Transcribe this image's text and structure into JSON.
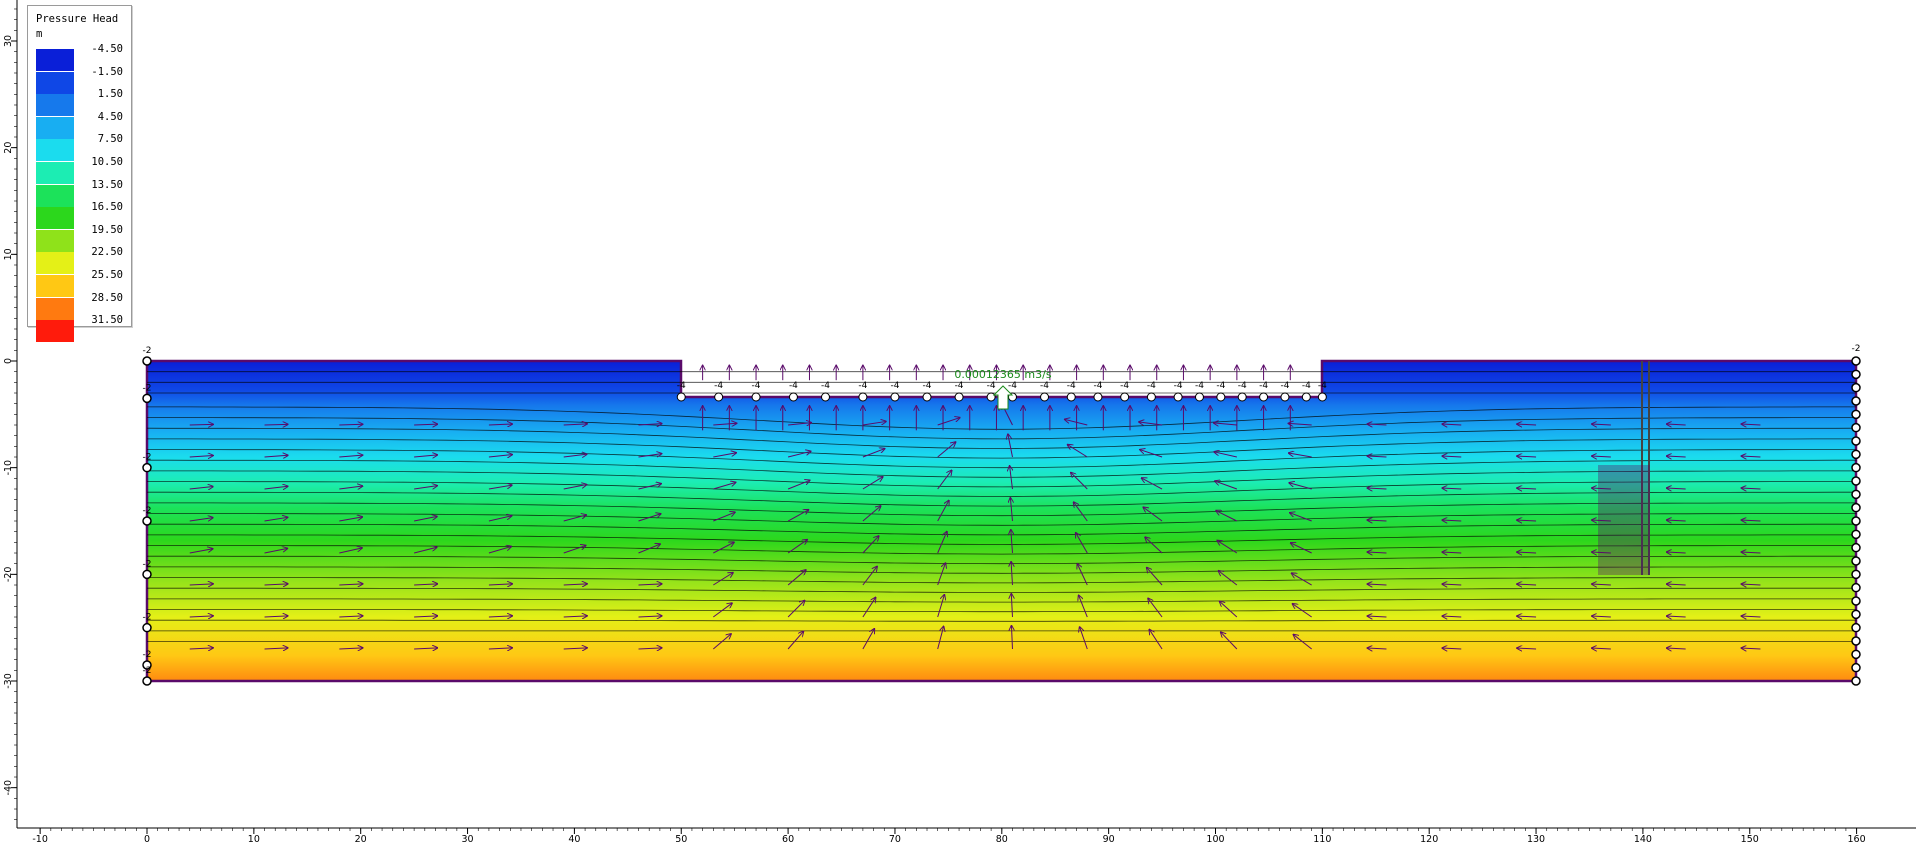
{
  "legend": {
    "title": "Pressure Head",
    "unit": "m",
    "entries": [
      {
        "label": "-4.50",
        "color": "#0a1fd8"
      },
      {
        "label": "-1.50",
        "color": "#0f47e6"
      },
      {
        "label": "1.50",
        "color": "#1679ec"
      },
      {
        "label": "4.50",
        "color": "#18aef2"
      },
      {
        "label": "7.50",
        "color": "#1bdcee"
      },
      {
        "label": "10.50",
        "color": "#1cedb3"
      },
      {
        "label": "13.50",
        "color": "#1ce25a"
      },
      {
        "label": "16.50",
        "color": "#2cd71c"
      },
      {
        "label": "19.50",
        "color": "#8fe21a"
      },
      {
        "label": "22.50",
        "color": "#e4f017"
      },
      {
        "label": "25.50",
        "color": "#ffc814"
      },
      {
        "label": "28.50",
        "color": "#ff7a10"
      },
      {
        "label": "31.50",
        "color": "#ff1b0c"
      }
    ]
  },
  "axes": {
    "x_ticks": [
      "-10",
      "0",
      "10",
      "20",
      "30",
      "40",
      "50",
      "60",
      "70",
      "80",
      "90",
      "100",
      "110",
      "120",
      "130",
      "140",
      "150",
      "160"
    ],
    "y_ticks": [
      "30",
      "20",
      "10",
      "0",
      "-10",
      "-20",
      "-30",
      "-40"
    ]
  },
  "annotations": {
    "flux": "0.00012365 m3/s",
    "left_node_value": "-2",
    "excavation_node_value": "-4"
  },
  "colors": {
    "boundary": "#5a0a6a",
    "vector": "#5a0a6a",
    "contour": "#000000",
    "flux_text": "#1a8a1a"
  },
  "model": {
    "x_range": [
      0,
      160
    ],
    "ground_elevation": 0,
    "excavation_x": [
      50,
      110
    ],
    "excavation_floor": -3.5,
    "bottom_elevation": -30
  }
}
